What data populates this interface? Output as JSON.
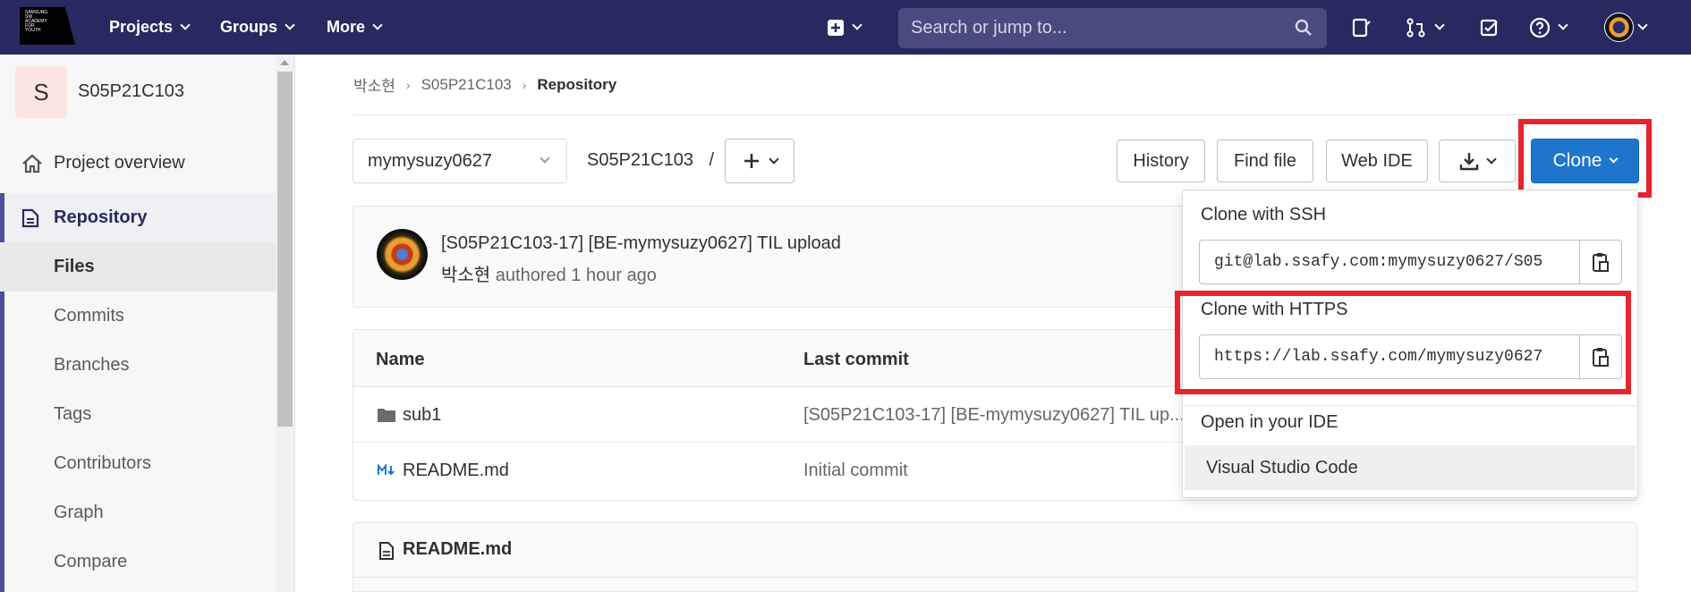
{
  "navbar": {
    "logo_text": "SAMSUNG SW ACADEMY FOR YOUTH",
    "projects": "Projects",
    "groups": "Groups",
    "more": "More",
    "search_placeholder": "Search or jump to..."
  },
  "sidebar": {
    "project_initial": "S",
    "project_name": "S05P21C103",
    "overview": "Project overview",
    "repository": "Repository",
    "items": [
      "Files",
      "Commits",
      "Branches",
      "Tags",
      "Contributors",
      "Graph",
      "Compare"
    ]
  },
  "breadcrumb": {
    "owner": "박소현",
    "project": "S05P21C103",
    "current": "Repository"
  },
  "toolbar": {
    "branch": "mymysuzy0627",
    "path": "S05P21C103",
    "path_sep": "/",
    "history": "History",
    "find_file": "Find file",
    "web_ide": "Web IDE",
    "clone": "Clone"
  },
  "commit": {
    "title": "[S05P21C103-17] [BE-mymysuzy0627] TIL upload",
    "author": "박소현",
    "authored": "authored",
    "time": "1 hour ago"
  },
  "file_tree": {
    "col_name": "Name",
    "col_last_commit": "Last commit",
    "rows": [
      {
        "name": "sub1",
        "last_commit": "[S05P21C103-17] [BE-mymysuzy0627] TIL up..."
      },
      {
        "name": "README.md",
        "last_commit": "Initial commit"
      }
    ]
  },
  "readme": {
    "title": "README.md"
  },
  "clone_dropdown": {
    "ssh_label": "Clone with SSH",
    "ssh_url": "git@lab.ssafy.com:mymysuzy0627/S05",
    "https_label": "Clone with HTTPS",
    "https_url": "https://lab.ssafy.com/mymysuzy0627",
    "ide_label": "Open in your IDE",
    "ide_item": "Visual Studio Code"
  },
  "colors": {
    "navbar": "#292961",
    "clone_button": "#1f75cb",
    "highlight": "#e8232d"
  }
}
